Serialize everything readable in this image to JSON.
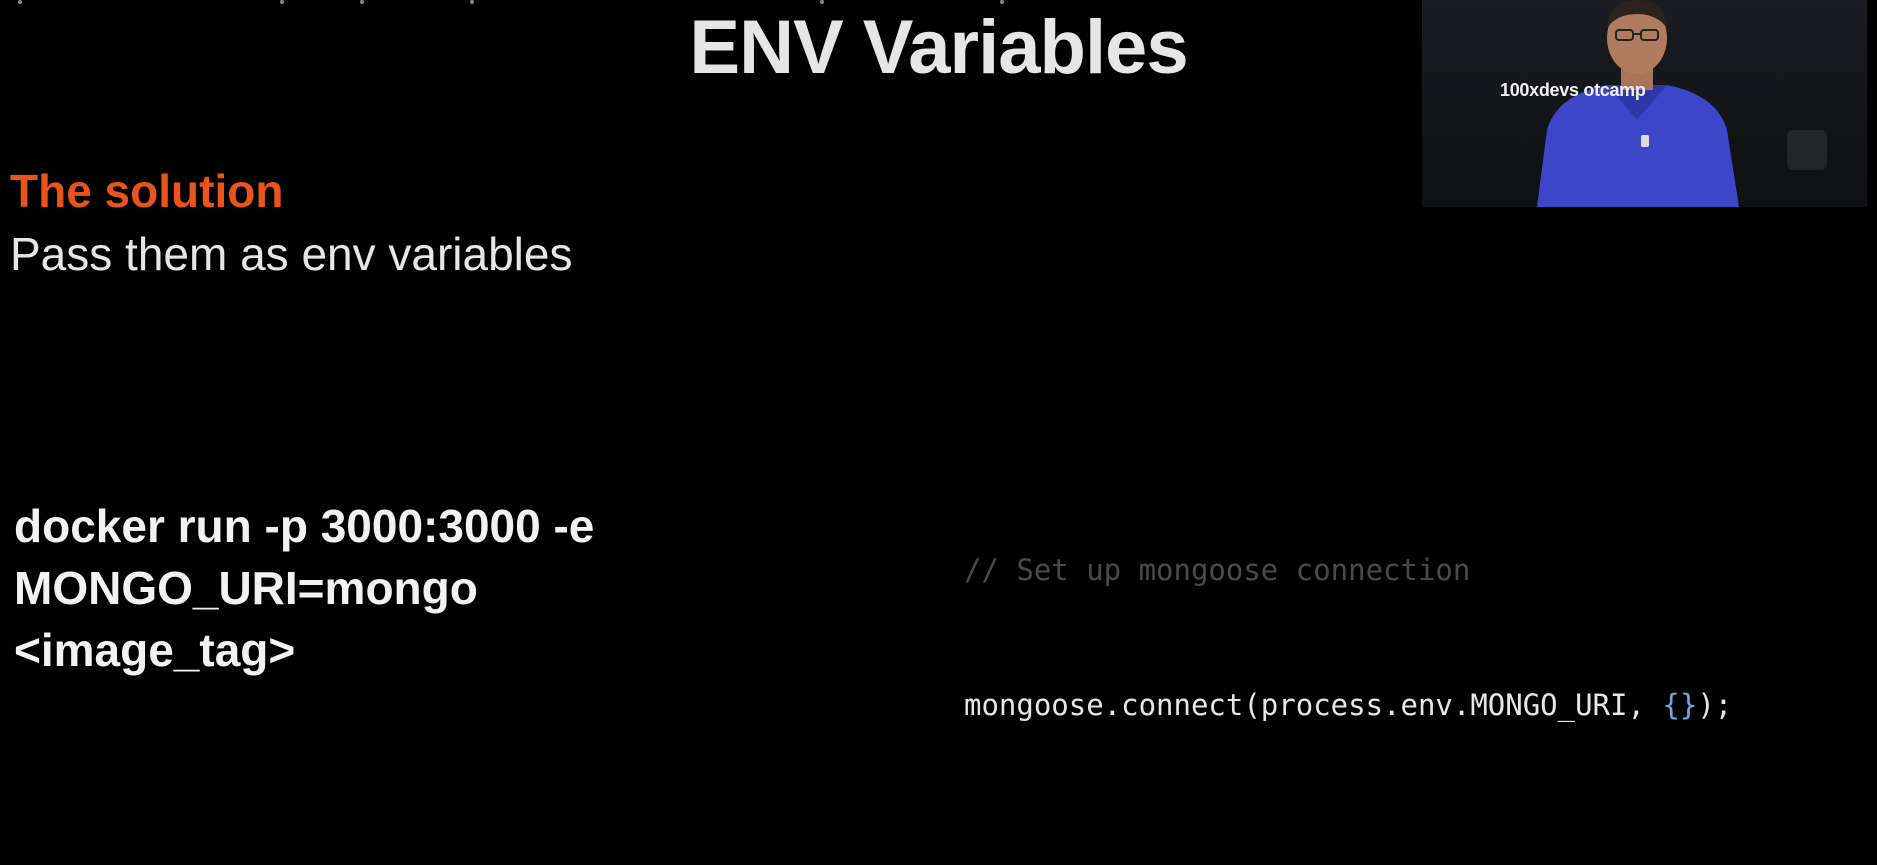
{
  "slide": {
    "title": "ENV Variables",
    "solution_heading": "The solution",
    "solution_text": "Pass them as env variables",
    "command_lines": [
      "docker run -p 3000:3000 -e",
      "MONGO_URI=mongo",
      "<image_tag>"
    ],
    "code": {
      "comment": "// Set up mongoose connection",
      "line_prefix": "mongoose.connect(process.env.MONGO_URI, ",
      "line_braces": "{}",
      "line_suffix": ");"
    }
  },
  "video_overlay": {
    "banner_text": "100xdevs              otcamp"
  },
  "colors": {
    "background": "#000000",
    "accent_orange": "#e8541c",
    "text_light": "#e6e6e6",
    "code_comment": "#4a4a4a",
    "code_braces": "#6fa8dc"
  }
}
